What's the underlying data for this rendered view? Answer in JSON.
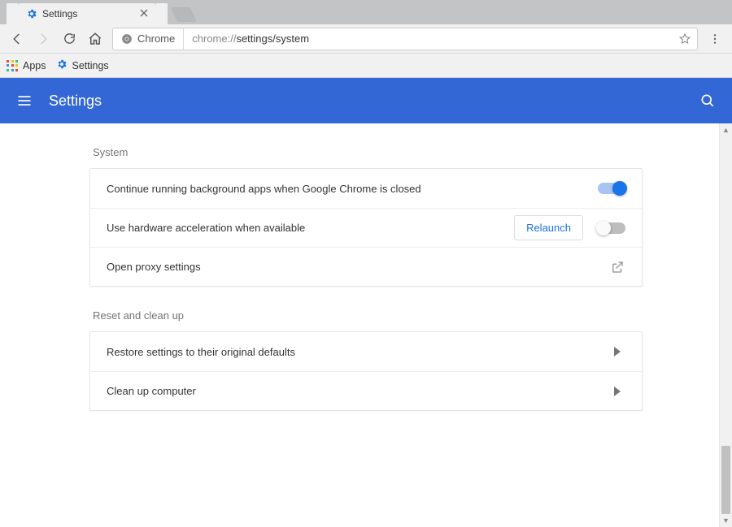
{
  "window": {
    "tab": {
      "title": "Settings"
    }
  },
  "omnibox": {
    "origin_label": "Chrome",
    "url_prefix": "chrome://",
    "url_path": "settings/system"
  },
  "bookmarks": {
    "apps": "Apps",
    "settings": "Settings"
  },
  "header": {
    "title": "Settings"
  },
  "sections": {
    "system": {
      "title": "System",
      "rows": {
        "bg_apps": {
          "label": "Continue running background apps when Google Chrome is closed"
        },
        "hw_accel": {
          "label": "Use hardware acceleration when available",
          "relaunch": "Relaunch"
        },
        "proxy": {
          "label": "Open proxy settings"
        }
      }
    },
    "reset": {
      "title": "Reset and clean up",
      "rows": {
        "restore": {
          "label": "Restore settings to their original defaults"
        },
        "cleanup": {
          "label": "Clean up computer"
        }
      }
    }
  }
}
